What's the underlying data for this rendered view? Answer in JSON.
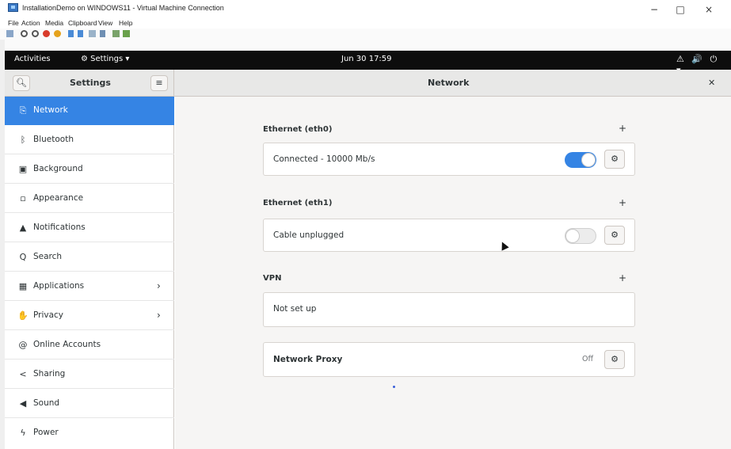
{
  "host": {
    "title": "InstallationDemo on WINDOWS11 - Virtual Machine Connection",
    "menu": [
      "File",
      "Action",
      "Media",
      "Clipboard",
      "View",
      "Help"
    ],
    "controls": {
      "minimize": "−",
      "maximize": "□",
      "close": "×"
    }
  },
  "topbar": {
    "activities": "Activities",
    "app_menu": "Settings ▾",
    "clock": "Jun 30 17:59",
    "tray": "⚠ 🔊 ⏻ ▾"
  },
  "header": {
    "search_icon": "search-icon",
    "sidebar_title": "Settings",
    "menu_icon": "hamburger-icon",
    "panel_title": "Network",
    "close_icon": "close-icon"
  },
  "sidebar": {
    "items": [
      {
        "label": "Network",
        "icon": "network-icon",
        "active": true,
        "chevron": false
      },
      {
        "label": "Bluetooth",
        "icon": "bluetooth-icon",
        "active": false,
        "chevron": false
      },
      {
        "label": "Background",
        "icon": "background-icon",
        "active": false,
        "chevron": false
      },
      {
        "label": "Appearance",
        "icon": "appearance-icon",
        "active": false,
        "chevron": false
      },
      {
        "label": "Notifications",
        "icon": "bell-icon",
        "active": false,
        "chevron": false
      },
      {
        "label": "Search",
        "icon": "search-icon",
        "active": false,
        "chevron": false
      },
      {
        "label": "Applications",
        "icon": "grid-icon",
        "active": false,
        "chevron": true
      },
      {
        "label": "Privacy",
        "icon": "hand-icon",
        "active": false,
        "chevron": true
      },
      {
        "label": "Online Accounts",
        "icon": "at-icon",
        "active": false,
        "chevron": false
      },
      {
        "label": "Sharing",
        "icon": "share-icon",
        "active": false,
        "chevron": false
      },
      {
        "label": "Sound",
        "icon": "speaker-icon",
        "active": false,
        "chevron": false
      },
      {
        "label": "Power",
        "icon": "power-icon",
        "active": false,
        "chevron": false
      }
    ]
  },
  "network": {
    "eth0": {
      "title": "Ethernet (eth0)",
      "status": "Connected - 10000 Mb/s",
      "enabled": true
    },
    "eth1": {
      "title": "Ethernet (eth1)",
      "status": "Cable unplugged",
      "enabled": false
    },
    "vpn": {
      "title": "VPN",
      "status": "Not set up"
    },
    "proxy": {
      "label": "Network Proxy",
      "state": "Off"
    },
    "add_symbol": "+",
    "gear_symbol": "⚙"
  },
  "colors": {
    "accent": "#3584e4",
    "topbar": "#0d0d0d"
  }
}
